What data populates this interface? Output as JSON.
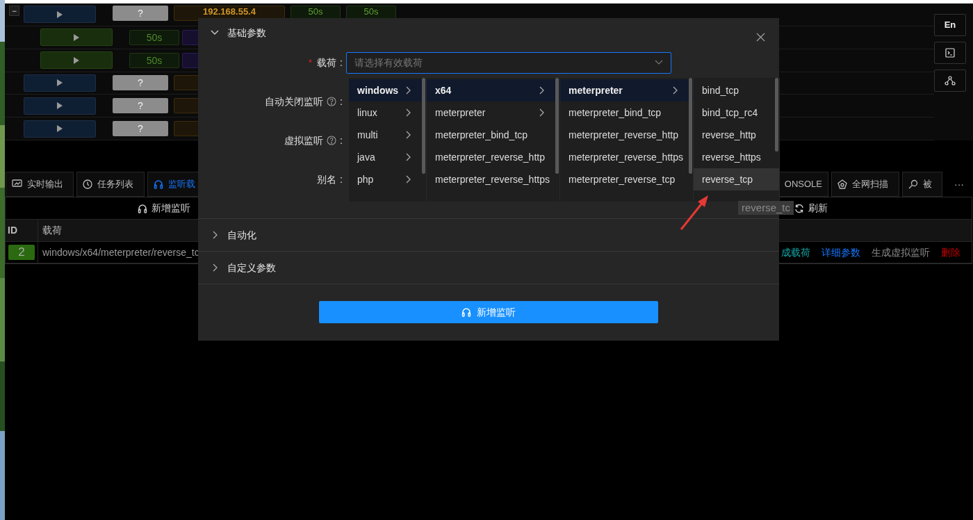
{
  "sessions": [
    {
      "kind": "parent",
      "toggle": "−",
      "status": "?",
      "address": "192.168.55.4",
      "times": [
        "50s",
        "50s"
      ]
    },
    {
      "kind": "child",
      "times": [
        "50s"
      ]
    },
    {
      "kind": "child",
      "times": [
        "50s"
      ]
    },
    {
      "kind": "parent",
      "status": "?"
    },
    {
      "kind": "parent",
      "status": "?"
    },
    {
      "kind": "parent",
      "status": "?"
    }
  ],
  "side_buttons": [
    {
      "kind": "text",
      "label": "En"
    },
    {
      "kind": "terminal"
    },
    {
      "kind": "network"
    }
  ],
  "tabs": [
    {
      "label": "实时输出",
      "kind": "monitor",
      "selected": false
    },
    {
      "label": "任务列表",
      "kind": "clock",
      "selected": false
    },
    {
      "label": "监听载",
      "kind": "headset",
      "selected": true
    }
  ],
  "right_tabs": [
    {
      "label": "ONSOLE",
      "kind": "plain",
      "selected": false
    },
    {
      "label": "全网扫描",
      "kind": "pentagon",
      "selected": false
    },
    {
      "label": "被",
      "kind": "search",
      "selected": false
    }
  ],
  "more": "···",
  "toolbar": {
    "add_button": "新增监听",
    "refresh_button": "刷新"
  },
  "table": {
    "columns": [
      "ID",
      "载荷"
    ],
    "rows": [
      {
        "id": "2",
        "payload": "windows/x64/meterpreter/reverse_tc",
        "actions": [
          {
            "label": "成载荷",
            "kind": "generate"
          },
          {
            "label": "详细参数",
            "kind": "detail"
          },
          {
            "label": "生成虚拟监听",
            "kind": "virtual"
          },
          {
            "label": "删除",
            "kind": "delete"
          }
        ]
      }
    ]
  },
  "tooltip": "reverse_tc",
  "dialog": {
    "sections": [
      {
        "title": "基础参数",
        "expanded": true,
        "fields": [
          {
            "label": "载荷",
            "required_mark": "*",
            "help": false,
            "colon": ":",
            "placeholder": "请选择有效载荷",
            "focused": true
          },
          {
            "label": "自动关闭监听",
            "help": true,
            "colon": ":"
          },
          {
            "label": "虚拟监听",
            "help": true,
            "colon": ":"
          },
          {
            "label": "别名",
            "help": false,
            "colon": ":"
          }
        ]
      },
      {
        "title": "自动化",
        "expanded": false
      },
      {
        "title": "自定义参数",
        "expanded": false
      }
    ],
    "submit": "新增监听"
  },
  "cascader": {
    "columns": [
      [
        {
          "label": "windows",
          "has_children": true,
          "selected": true,
          "hovered": false
        },
        {
          "label": "linux",
          "has_children": true,
          "selected": false,
          "hovered": false
        },
        {
          "label": "multi",
          "has_children": true,
          "selected": false,
          "hovered": false
        },
        {
          "label": "java",
          "has_children": true,
          "selected": false,
          "hovered": false
        },
        {
          "label": "php",
          "has_children": true,
          "selected": false,
          "hovered": false
        }
      ],
      [
        {
          "label": "x64",
          "has_children": true,
          "selected": true,
          "hovered": false
        },
        {
          "label": "meterpreter",
          "has_children": true,
          "selected": false,
          "hovered": false
        },
        {
          "label": "meterpreter_bind_tcp",
          "has_children": false,
          "selected": false,
          "hovered": false
        },
        {
          "label": "meterpreter_reverse_http",
          "has_children": false,
          "selected": false,
          "hovered": false
        },
        {
          "label": "meterpreter_reverse_https",
          "has_children": false,
          "selected": false,
          "hovered": false
        }
      ],
      [
        {
          "label": "meterpreter",
          "has_children": true,
          "selected": true,
          "hovered": false
        },
        {
          "label": "meterpreter_bind_tcp",
          "has_children": false,
          "selected": false,
          "hovered": false
        },
        {
          "label": "meterpreter_reverse_http",
          "has_children": false,
          "selected": false,
          "hovered": false
        },
        {
          "label": "meterpreter_reverse_https",
          "has_children": false,
          "selected": false,
          "hovered": false
        },
        {
          "label": "meterpreter_reverse_tcp",
          "has_children": false,
          "selected": false,
          "hovered": false
        }
      ],
      [
        {
          "label": "bind_tcp",
          "has_children": false,
          "selected": false,
          "hovered": false
        },
        {
          "label": "bind_tcp_rc4",
          "has_children": false,
          "selected": false,
          "hovered": false
        },
        {
          "label": "reverse_http",
          "has_children": false,
          "selected": false,
          "hovered": false
        },
        {
          "label": "reverse_https",
          "has_children": false,
          "selected": false,
          "hovered": false
        },
        {
          "label": "reverse_tcp",
          "has_children": false,
          "selected": false,
          "hovered": true
        }
      ]
    ]
  }
}
